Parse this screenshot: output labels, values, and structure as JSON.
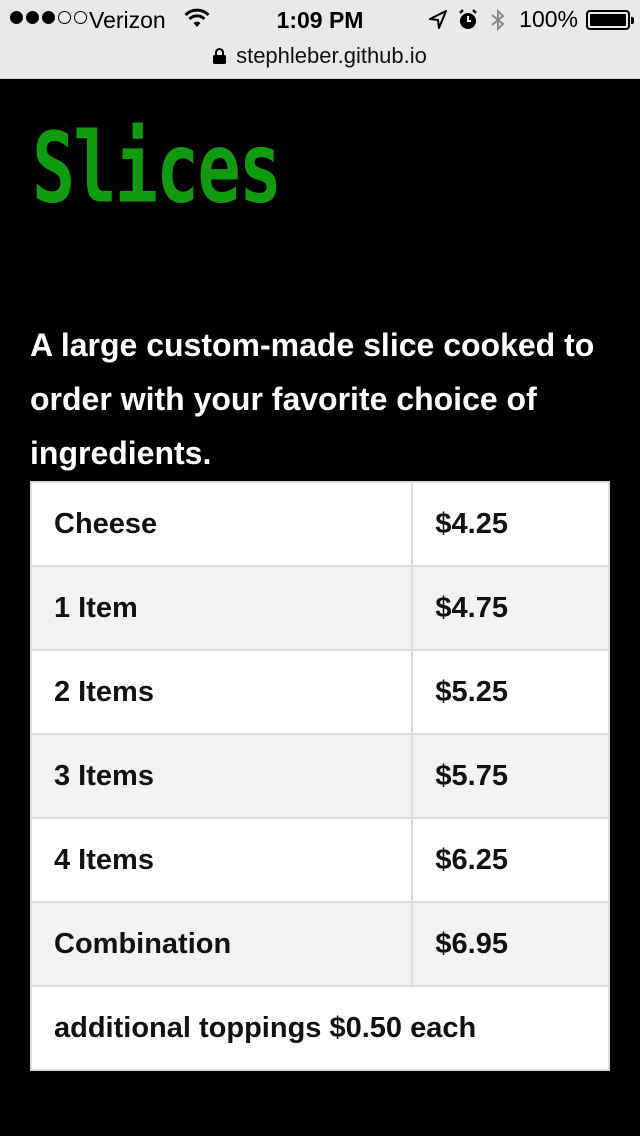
{
  "status_bar": {
    "carrier": "Verizon",
    "time": "1:09 PM",
    "battery": "100%"
  },
  "url_bar": {
    "url": "stephleber.github.io"
  },
  "page": {
    "title": "Slices",
    "intro": "A large custom-made slice cooked to order with your favorite choice of ingredients.",
    "menu": [
      {
        "item": "Cheese",
        "price": "$4.25"
      },
      {
        "item": "1 Item",
        "price": "$4.75"
      },
      {
        "item": "2 Items",
        "price": "$5.25"
      },
      {
        "item": "3 Items",
        "price": "$5.75"
      },
      {
        "item": "4 Items",
        "price": "$6.25"
      },
      {
        "item": "Combination",
        "price": "$6.95"
      }
    ],
    "footnote": "additional toppings $0.50 each"
  },
  "colors": {
    "title": "#119b11",
    "background": "#000000",
    "table_alt_row": "#f2f2f2"
  }
}
